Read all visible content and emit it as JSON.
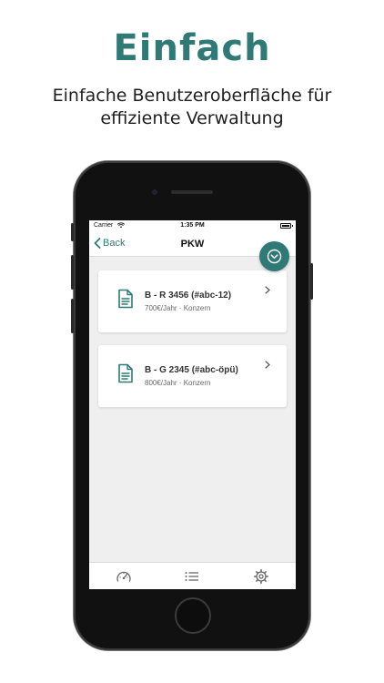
{
  "promo": {
    "headline": "Einfach",
    "subline": "Einfache Benutzeroberfläche für\neffiziente Verwaltung"
  },
  "status_bar": {
    "carrier": "Carrier",
    "time": "1:35 PM"
  },
  "nav": {
    "back_label": "Back",
    "title": "PKW"
  },
  "colors": {
    "accent": "#2f7a76",
    "headline": "#2f7a76"
  },
  "vehicles": [
    {
      "title": "B - R 3456 (#abc-12)",
      "subtitle": "700€/Jahr · Konzern",
      "icon": "document-icon"
    },
    {
      "title": "B - G 2345 (#abc-öpü)",
      "subtitle": "800€/Jahr · Konzern",
      "icon": "document-icon"
    }
  ],
  "tabs": [
    {
      "name": "dashboard",
      "icon": "speedometer-icon"
    },
    {
      "name": "list",
      "icon": "list-icon"
    },
    {
      "name": "settings",
      "icon": "gear-icon"
    }
  ]
}
